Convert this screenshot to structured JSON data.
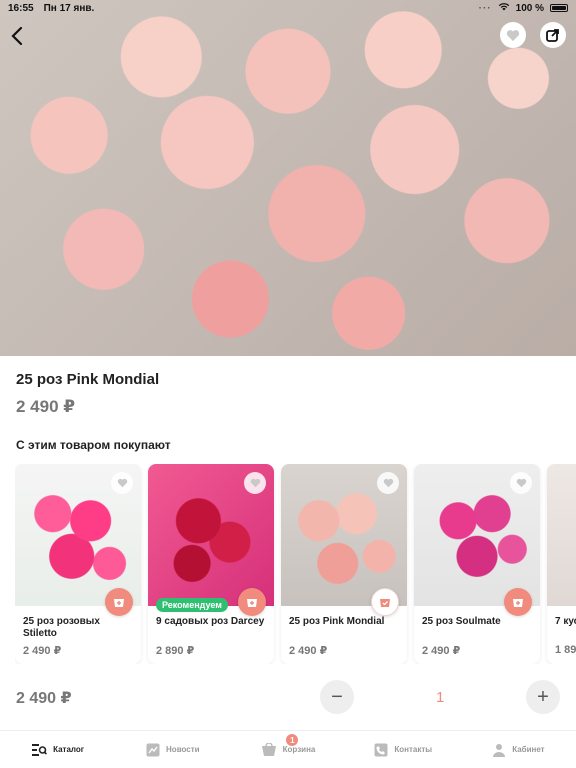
{
  "status": {
    "time": "16:55",
    "date": "Пн 17 янв.",
    "battery": "100 %"
  },
  "product": {
    "title": "25 роз Pink Mondial",
    "price": "2 490 ₽"
  },
  "related": {
    "title": "С этим товаром покупают",
    "items": [
      {
        "name": "25 роз розовых Stiletto",
        "price": "2 490 ₽"
      },
      {
        "name": "9 садовых роз Darcey",
        "price": "2 890 ₽",
        "badge": "Рекомендуем"
      },
      {
        "name": "25 роз Pink Mondial",
        "price": "2 490 ₽"
      },
      {
        "name": "25 роз Soulmate",
        "price": "2 490 ₽"
      },
      {
        "name": "7 кус",
        "price": "1 89"
      }
    ]
  },
  "bottom": {
    "price": "2 490 ₽",
    "qty": "1",
    "minus": "−",
    "plus": "+"
  },
  "tabs": [
    {
      "label": "Каталог",
      "icon": "catalog-icon"
    },
    {
      "label": "Новости",
      "icon": "news-icon"
    },
    {
      "label": "Корзина",
      "icon": "cart-icon",
      "badge": "1"
    },
    {
      "label": "Контакты",
      "icon": "phone-icon"
    },
    {
      "label": "Кабинет",
      "icon": "profile-icon"
    }
  ],
  "colors": {
    "accent": "#f08b7d",
    "badge_green": "#2fbf71",
    "price_gray": "#777777"
  }
}
